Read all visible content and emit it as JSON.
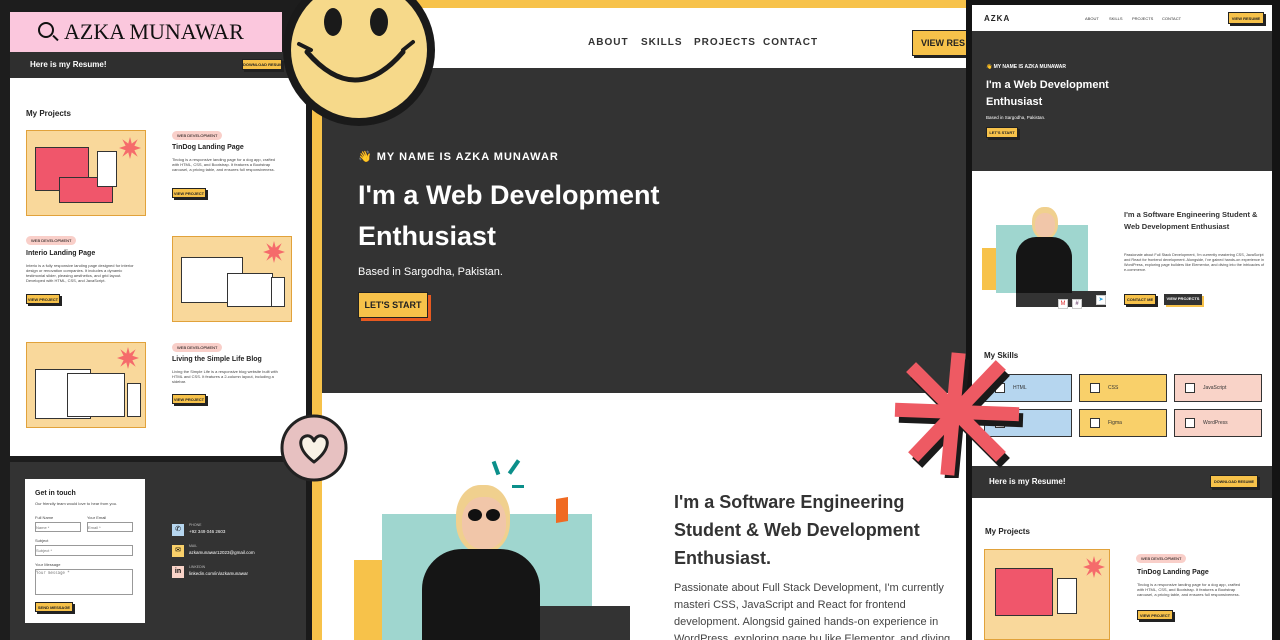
{
  "logo_banner": {
    "text": "AZKA MUNAWAR"
  },
  "resume_bar": {
    "title": "Here is my Resume!",
    "button": "DOWNLOAD RESUME"
  },
  "nav": {
    "logo": "AZKA",
    "items": [
      "ABOUT",
      "SKILLS",
      "PROJECTS",
      "CONTACT"
    ],
    "cta": "VIEW RESUME",
    "cta_cut": "VIEW RES"
  },
  "hero": {
    "eyebrow": "👋 MY NAME IS AZKA MUNAWAR",
    "title": "I'm a Web Development Enthusiast",
    "subtitle": "Based in Sargodha, Pakistan.",
    "button": "LET'S START"
  },
  "about": {
    "title": "I'm a Software Engineering Student & Web Development Enthusiast.",
    "title_right": "I'm a Software Engineering Student & Web Development Enthusiast",
    "body_cut": "Passionate about Full Stack Development, I'm currently masteri CSS, JavaScript and React for frontend development. Alongsid gained hands-on experience in WordPress, exploring page bu like Elementor, and diving into the intricacies of e-commerce",
    "body": "Passionate about Full Stack Development, I'm currently mastering CSS, JavaScript and React for frontend development. Alongside, I've gained hands-on experience in WordPress, exploring page builders like Elementor, and diving into the intricacies of e-commerce.",
    "buttons": [
      "CONTACT ME",
      "VIEW PROJECTS"
    ]
  },
  "skills": {
    "title": "My Skills",
    "items": [
      "HTML",
      "CSS",
      "JavaScript",
      "",
      "Figma",
      "WordPress"
    ],
    "colors": [
      "#b6d6ef",
      "#f9d06a",
      "#f9d3c8",
      "#b6d6ef",
      "#f9d06a",
      "#f9d3c8"
    ]
  },
  "projects": {
    "title": "My Projects",
    "items": [
      {
        "tag": "WEB DEVELOPMENT",
        "title": "TinDog Landing Page",
        "desc": "Tindog is a responsive landing page for a dog app, crafted with HTML, CSS, and Bootstrap. It features a Bootstrap carousel, a pricing table, and ensures full responsiveness.",
        "button": "VIEW PROJECT"
      },
      {
        "tag": "WEB DEVELOPMENT",
        "title": "Interio Landing Page",
        "desc": "Interio is a fully responsive landing page designed for interior design or renovation companies. It includes a dynamic testimonial slider, pleasing aesthetics, and grid layout. Developed with HTML, CSS, and JavaScript.",
        "button": "VIEW PROJECT"
      },
      {
        "tag": "WEB DEVELOPMENT",
        "title": "Living the Simple Life Blog",
        "desc": "Living the Simple Life is a responsive blog website built with HTML and CSS. It features a 2-column layout, including a sidebar.",
        "button": "VIEW PROJECT"
      }
    ]
  },
  "contact": {
    "title": "Get in touch",
    "subtitle": "Our friendly team would love to hear from you.",
    "fields": [
      {
        "label": "Full Name",
        "placeholder": "Name *"
      },
      {
        "label": "Your Email",
        "placeholder": "Email *"
      },
      {
        "label": "Subject",
        "placeholder": "Subject *"
      },
      {
        "label": "Your Message",
        "placeholder": "Your message *"
      }
    ],
    "submit": "SEND MESSAGE",
    "info": [
      {
        "label": "PHONE",
        "value": "+92 349 046 2603"
      },
      {
        "label": "MAIL",
        "value": "azkamunawar12023@gmail.com"
      },
      {
        "label": "LINKEDIN",
        "value": "linkedin.com/in/azkamunawar"
      }
    ]
  },
  "colors": {
    "accent": "#f7c24a",
    "dark": "#333333",
    "pink": "#f9cfc9",
    "coral": "#f04e5b",
    "banner": "#fbc7dd"
  }
}
